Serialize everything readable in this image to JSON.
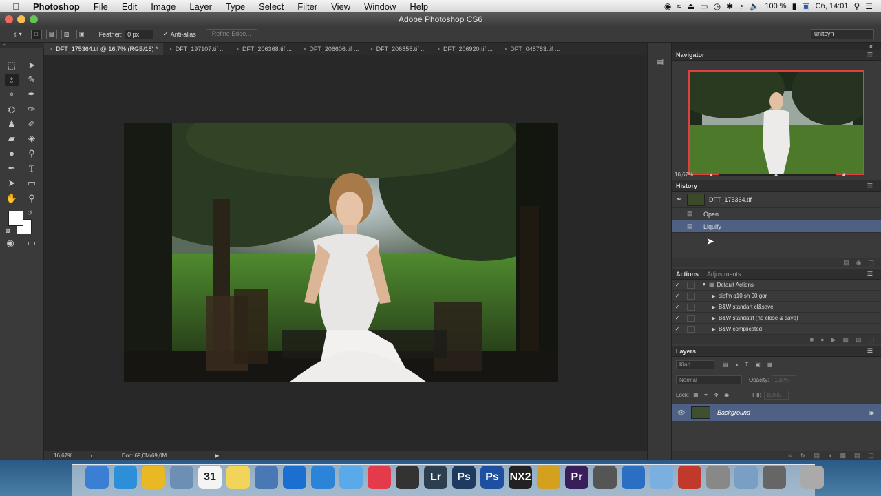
{
  "menubar": {
    "app": "Photoshop",
    "items": [
      "File",
      "Edit",
      "Image",
      "Layer",
      "Type",
      "Select",
      "Filter",
      "View",
      "Window",
      "Help"
    ],
    "battery": "100 %",
    "clock": "Сб, 14:01"
  },
  "window": {
    "title": "Adobe Photoshop CS6"
  },
  "options": {
    "feather_label": "Feather:",
    "feather_value": "0 px",
    "antialias_label": "Anti-alias",
    "refine_label": "Refine Edge...",
    "workspace": "unitsyn"
  },
  "tabs": [
    {
      "label": "DFT_175364.tif @ 16,7% (RGB/16) *",
      "active": true
    },
    {
      "label": "DFT_197107.tif ..."
    },
    {
      "label": "DFT_206368.tif ..."
    },
    {
      "label": "DFT_206606.tif ..."
    },
    {
      "label": "DFT_206855.tif ..."
    },
    {
      "label": "DFT_206920.tif ..."
    },
    {
      "label": "DFT_048783.tif ..."
    }
  ],
  "status": {
    "zoom": "16,67%",
    "doc": "Doc: 69,0M/69,0M"
  },
  "navigator": {
    "title": "Navigator",
    "zoom": "16,67%"
  },
  "history": {
    "title": "History",
    "snapshot": "DFT_175364.tif",
    "items": [
      {
        "label": "Open"
      },
      {
        "label": "Liquify",
        "selected": true
      }
    ]
  },
  "actions": {
    "title": "Actions",
    "tab2": "Adjustments",
    "set": "Default Actions",
    "items": [
      "sibfm q10 sh 90 gor",
      "B&W standart cl&save",
      "B&W standatrt (no close & save)",
      "B&W complicated"
    ]
  },
  "layers": {
    "title": "Layers",
    "kind": "Kind",
    "blend": "Normal",
    "opacity_label": "Opacity:",
    "opacity": "100%",
    "lock_label": "Lock:",
    "fill_label": "Fill:",
    "fill": "100%",
    "layer_name": "Background"
  },
  "dock": {
    "items": [
      {
        "name": "finder-icon",
        "label": "",
        "color": "#3b7fd4"
      },
      {
        "name": "safari-icon",
        "label": "",
        "color": "#2d8fd8"
      },
      {
        "name": "chrome-icon",
        "label": "",
        "color": "#e8b923"
      },
      {
        "name": "mail-icon",
        "label": "",
        "color": "#6d8fb4"
      },
      {
        "name": "calendar-icon",
        "label": "31",
        "color": "#f4f4f4"
      },
      {
        "name": "notes-icon",
        "label": "",
        "color": "#f1d55a"
      },
      {
        "name": "preview-icon",
        "label": "",
        "color": "#4a78b5"
      },
      {
        "name": "teamviewer-icon",
        "label": "",
        "color": "#1a6fd1"
      },
      {
        "name": "appstore-icon",
        "label": "",
        "color": "#2b84d8"
      },
      {
        "name": "messages-icon",
        "label": "",
        "color": "#5aa9e8"
      },
      {
        "name": "itunes-icon",
        "label": "",
        "color": "#e43b4b"
      },
      {
        "name": "aperture-icon",
        "label": "",
        "color": "#333"
      },
      {
        "name": "lightroom-icon",
        "label": "Lr",
        "color": "#2d3e50"
      },
      {
        "name": "photoshop-icon",
        "label": "Ps",
        "color": "#1e3a5f"
      },
      {
        "name": "photoshop2-icon",
        "label": "Ps",
        "color": "#1f4fa0"
      },
      {
        "name": "nx2-icon",
        "label": "NX2",
        "color": "#222"
      },
      {
        "name": "colorsync-icon",
        "label": "",
        "color": "#d4a020"
      },
      {
        "name": "premiere-icon",
        "label": "Pr",
        "color": "#3a1e5a"
      },
      {
        "name": "finalcut-icon",
        "label": "",
        "color": "#555"
      },
      {
        "name": "quicktime-icon",
        "label": "",
        "color": "#2a6fc4"
      },
      {
        "name": "screens-icon",
        "label": "",
        "color": "#7ab0e0"
      },
      {
        "name": "filezilla-icon",
        "label": "",
        "color": "#c0392b"
      },
      {
        "name": "syspref-icon",
        "label": "",
        "color": "#888"
      },
      {
        "name": "iphoto-icon",
        "label": "",
        "color": "#7a9fc4"
      },
      {
        "name": "stack-icon",
        "label": "",
        "color": "#666"
      },
      {
        "name": "trash-icon",
        "label": "",
        "color": "#aaa"
      }
    ]
  }
}
